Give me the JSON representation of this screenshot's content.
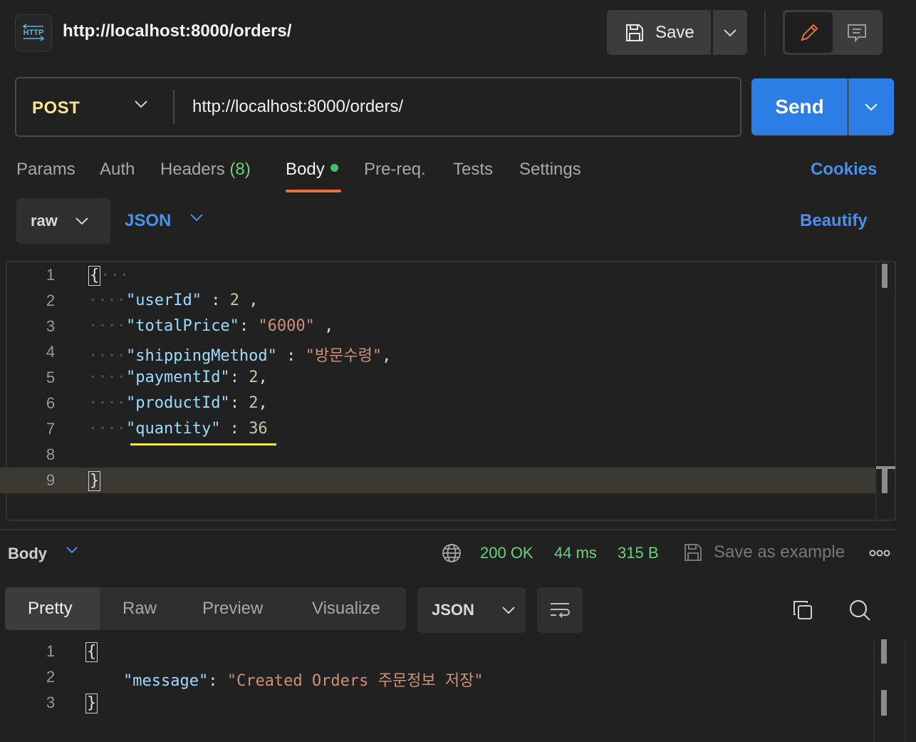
{
  "request": {
    "title": "http://localhost:8000/orders/",
    "badge": "HTTP",
    "save_label": "Save",
    "method": "POST",
    "url": "http://localhost:8000/orders/",
    "send_label": "Send"
  },
  "tabs": [
    {
      "label": "Params"
    },
    {
      "label": "Auth"
    },
    {
      "label": "Headers",
      "count": "(8)"
    },
    {
      "label": "Body",
      "active": true
    },
    {
      "label": "Pre-req."
    },
    {
      "label": "Tests"
    },
    {
      "label": "Settings"
    }
  ],
  "cookies_label": "Cookies",
  "body_options": {
    "mode": "raw",
    "language": "JSON",
    "beautify_label": "Beautify"
  },
  "editor": {
    "line_numbers": [
      "1",
      "2",
      "3",
      "4",
      "5",
      "6",
      "7",
      "8",
      "9"
    ],
    "lines": {
      "l1": {
        "brace": "{"
      },
      "l2": {
        "key": "\"userId\"",
        "sep": " : ",
        "value": "2",
        "end": " ,"
      },
      "l3": {
        "key": "\"totalPrice\"",
        "sep": ": ",
        "value": "\"6000\"",
        "end": " ,"
      },
      "l4": {
        "key": "\"shippingMethod\"",
        "sep": " : ",
        "value": "\"방문수령\"",
        "end": ","
      },
      "l5": {
        "key": "\"paymentId\"",
        "sep": ": ",
        "value": "2",
        "end": ","
      },
      "l6": {
        "key": "\"productId\"",
        "sep": ": ",
        "value": "2",
        "end": ","
      },
      "l7": {
        "key": "\"quantity\"",
        "sep": " : ",
        "value": "36",
        "end": ""
      },
      "l9": {
        "brace": "}"
      }
    }
  },
  "response": {
    "section_label": "Body",
    "status": "200 OK",
    "time": "44 ms",
    "size": "315 B",
    "save_example_label": "Save as example",
    "view_tabs": [
      "Pretty",
      "Raw",
      "Preview",
      "Visualize"
    ],
    "language": "JSON",
    "line_numbers": [
      "1",
      "2",
      "3"
    ],
    "lines": {
      "l1": {
        "brace": "{"
      },
      "l2": {
        "key": "\"message\"",
        "sep": ": ",
        "value": "\"Created Orders 주문정보 저장\""
      },
      "l3": {
        "brace": "}"
      }
    }
  },
  "colors": {
    "accent": "#2d7de6",
    "link": "#4a90e8",
    "method": "#ffe58f",
    "success": "#6fcf7e",
    "tab_underline": "#f26b3a"
  },
  "icons": [
    "http-icon",
    "save-icon",
    "chevron-down-icon",
    "pencil-icon",
    "comment-icon",
    "globe-icon",
    "more-icon",
    "wrap-icon",
    "copy-icon",
    "search-icon"
  ]
}
